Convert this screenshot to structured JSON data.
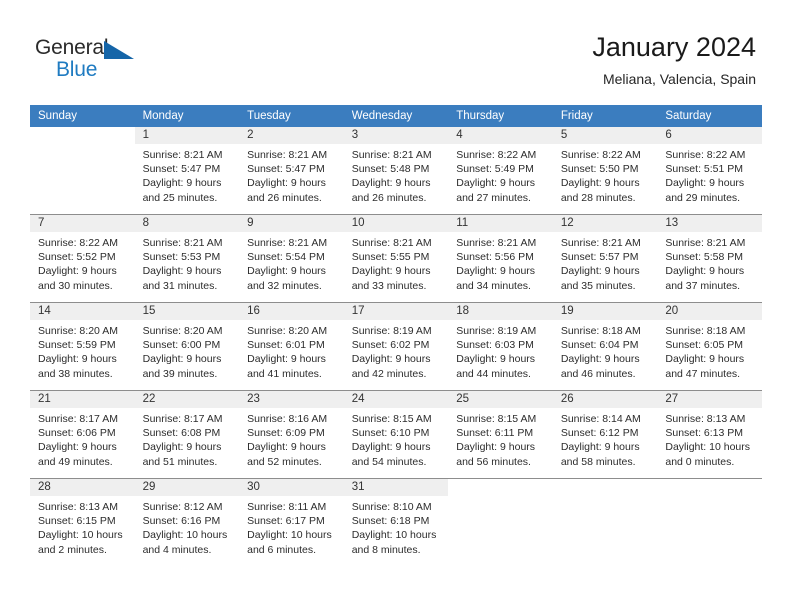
{
  "brand": {
    "name_top": "General",
    "name_bottom": "Blue",
    "accent_color": "#1f7bc1",
    "triangle_color": "#1565a8"
  },
  "header": {
    "title": "January 2024",
    "location": "Meliana, Valencia, Spain",
    "header_bg_color": "#3b7dbf",
    "daynum_bg_color": "#efefef"
  },
  "weekdays": [
    "Sunday",
    "Monday",
    "Tuesday",
    "Wednesday",
    "Thursday",
    "Friday",
    "Saturday"
  ],
  "labels": {
    "sunrise": "Sunrise:",
    "sunset": "Sunset:",
    "daylight": "Daylight:"
  },
  "weeks": [
    [
      {
        "day": "",
        "l1": "",
        "l2": "",
        "l3": "",
        "l4": ""
      },
      {
        "day": "1",
        "l1": "Sunrise: 8:21 AM",
        "l2": "Sunset: 5:47 PM",
        "l3": "Daylight: 9 hours",
        "l4": "and 25 minutes."
      },
      {
        "day": "2",
        "l1": "Sunrise: 8:21 AM",
        "l2": "Sunset: 5:47 PM",
        "l3": "Daylight: 9 hours",
        "l4": "and 26 minutes."
      },
      {
        "day": "3",
        "l1": "Sunrise: 8:21 AM",
        "l2": "Sunset: 5:48 PM",
        "l3": "Daylight: 9 hours",
        "l4": "and 26 minutes."
      },
      {
        "day": "4",
        "l1": "Sunrise: 8:22 AM",
        "l2": "Sunset: 5:49 PM",
        "l3": "Daylight: 9 hours",
        "l4": "and 27 minutes."
      },
      {
        "day": "5",
        "l1": "Sunrise: 8:22 AM",
        "l2": "Sunset: 5:50 PM",
        "l3": "Daylight: 9 hours",
        "l4": "and 28 minutes."
      },
      {
        "day": "6",
        "l1": "Sunrise: 8:22 AM",
        "l2": "Sunset: 5:51 PM",
        "l3": "Daylight: 9 hours",
        "l4": "and 29 minutes."
      }
    ],
    [
      {
        "day": "7",
        "l1": "Sunrise: 8:22 AM",
        "l2": "Sunset: 5:52 PM",
        "l3": "Daylight: 9 hours",
        "l4": "and 30 minutes."
      },
      {
        "day": "8",
        "l1": "Sunrise: 8:21 AM",
        "l2": "Sunset: 5:53 PM",
        "l3": "Daylight: 9 hours",
        "l4": "and 31 minutes."
      },
      {
        "day": "9",
        "l1": "Sunrise: 8:21 AM",
        "l2": "Sunset: 5:54 PM",
        "l3": "Daylight: 9 hours",
        "l4": "and 32 minutes."
      },
      {
        "day": "10",
        "l1": "Sunrise: 8:21 AM",
        "l2": "Sunset: 5:55 PM",
        "l3": "Daylight: 9 hours",
        "l4": "and 33 minutes."
      },
      {
        "day": "11",
        "l1": "Sunrise: 8:21 AM",
        "l2": "Sunset: 5:56 PM",
        "l3": "Daylight: 9 hours",
        "l4": "and 34 minutes."
      },
      {
        "day": "12",
        "l1": "Sunrise: 8:21 AM",
        "l2": "Sunset: 5:57 PM",
        "l3": "Daylight: 9 hours",
        "l4": "and 35 minutes."
      },
      {
        "day": "13",
        "l1": "Sunrise: 8:21 AM",
        "l2": "Sunset: 5:58 PM",
        "l3": "Daylight: 9 hours",
        "l4": "and 37 minutes."
      }
    ],
    [
      {
        "day": "14",
        "l1": "Sunrise: 8:20 AM",
        "l2": "Sunset: 5:59 PM",
        "l3": "Daylight: 9 hours",
        "l4": "and 38 minutes."
      },
      {
        "day": "15",
        "l1": "Sunrise: 8:20 AM",
        "l2": "Sunset: 6:00 PM",
        "l3": "Daylight: 9 hours",
        "l4": "and 39 minutes."
      },
      {
        "day": "16",
        "l1": "Sunrise: 8:20 AM",
        "l2": "Sunset: 6:01 PM",
        "l3": "Daylight: 9 hours",
        "l4": "and 41 minutes."
      },
      {
        "day": "17",
        "l1": "Sunrise: 8:19 AM",
        "l2": "Sunset: 6:02 PM",
        "l3": "Daylight: 9 hours",
        "l4": "and 42 minutes."
      },
      {
        "day": "18",
        "l1": "Sunrise: 8:19 AM",
        "l2": "Sunset: 6:03 PM",
        "l3": "Daylight: 9 hours",
        "l4": "and 44 minutes."
      },
      {
        "day": "19",
        "l1": "Sunrise: 8:18 AM",
        "l2": "Sunset: 6:04 PM",
        "l3": "Daylight: 9 hours",
        "l4": "and 46 minutes."
      },
      {
        "day": "20",
        "l1": "Sunrise: 8:18 AM",
        "l2": "Sunset: 6:05 PM",
        "l3": "Daylight: 9 hours",
        "l4": "and 47 minutes."
      }
    ],
    [
      {
        "day": "21",
        "l1": "Sunrise: 8:17 AM",
        "l2": "Sunset: 6:06 PM",
        "l3": "Daylight: 9 hours",
        "l4": "and 49 minutes."
      },
      {
        "day": "22",
        "l1": "Sunrise: 8:17 AM",
        "l2": "Sunset: 6:08 PM",
        "l3": "Daylight: 9 hours",
        "l4": "and 51 minutes."
      },
      {
        "day": "23",
        "l1": "Sunrise: 8:16 AM",
        "l2": "Sunset: 6:09 PM",
        "l3": "Daylight: 9 hours",
        "l4": "and 52 minutes."
      },
      {
        "day": "24",
        "l1": "Sunrise: 8:15 AM",
        "l2": "Sunset: 6:10 PM",
        "l3": "Daylight: 9 hours",
        "l4": "and 54 minutes."
      },
      {
        "day": "25",
        "l1": "Sunrise: 8:15 AM",
        "l2": "Sunset: 6:11 PM",
        "l3": "Daylight: 9 hours",
        "l4": "and 56 minutes."
      },
      {
        "day": "26",
        "l1": "Sunrise: 8:14 AM",
        "l2": "Sunset: 6:12 PM",
        "l3": "Daylight: 9 hours",
        "l4": "and 58 minutes."
      },
      {
        "day": "27",
        "l1": "Sunrise: 8:13 AM",
        "l2": "Sunset: 6:13 PM",
        "l3": "Daylight: 10 hours",
        "l4": "and 0 minutes."
      }
    ],
    [
      {
        "day": "28",
        "l1": "Sunrise: 8:13 AM",
        "l2": "Sunset: 6:15 PM",
        "l3": "Daylight: 10 hours",
        "l4": "and 2 minutes."
      },
      {
        "day": "29",
        "l1": "Sunrise: 8:12 AM",
        "l2": "Sunset: 6:16 PM",
        "l3": "Daylight: 10 hours",
        "l4": "and 4 minutes."
      },
      {
        "day": "30",
        "l1": "Sunrise: 8:11 AM",
        "l2": "Sunset: 6:17 PM",
        "l3": "Daylight: 10 hours",
        "l4": "and 6 minutes."
      },
      {
        "day": "31",
        "l1": "Sunrise: 8:10 AM",
        "l2": "Sunset: 6:18 PM",
        "l3": "Daylight: 10 hours",
        "l4": "and 8 minutes."
      },
      {
        "day": "",
        "l1": "",
        "l2": "",
        "l3": "",
        "l4": ""
      },
      {
        "day": "",
        "l1": "",
        "l2": "",
        "l3": "",
        "l4": ""
      },
      {
        "day": "",
        "l1": "",
        "l2": "",
        "l3": "",
        "l4": ""
      }
    ]
  ]
}
